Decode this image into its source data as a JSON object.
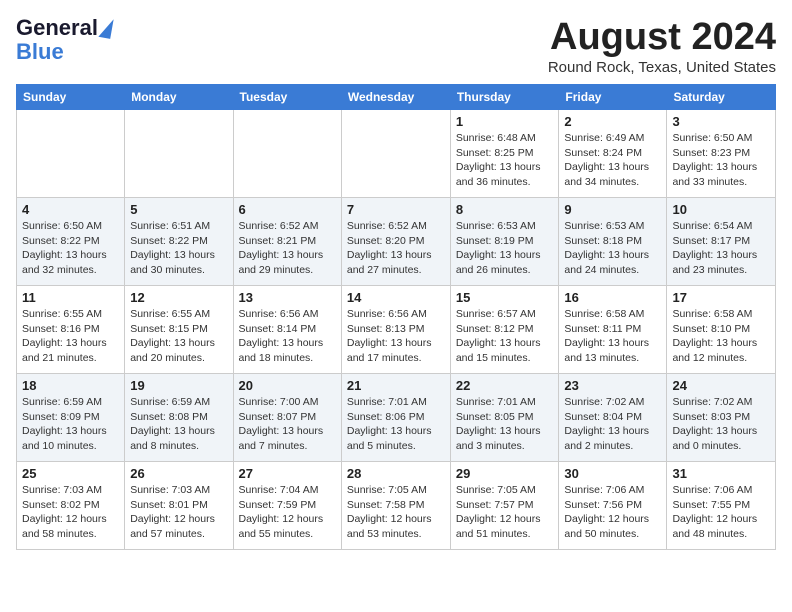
{
  "header": {
    "logo_line1": "General",
    "logo_line2": "Blue",
    "month_title": "August 2024",
    "location": "Round Rock, Texas, United States"
  },
  "days_of_week": [
    "Sunday",
    "Monday",
    "Tuesday",
    "Wednesday",
    "Thursday",
    "Friday",
    "Saturday"
  ],
  "weeks": [
    [
      {
        "day": "",
        "detail": ""
      },
      {
        "day": "",
        "detail": ""
      },
      {
        "day": "",
        "detail": ""
      },
      {
        "day": "",
        "detail": ""
      },
      {
        "day": "1",
        "detail": "Sunrise: 6:48 AM\nSunset: 8:25 PM\nDaylight: 13 hours\nand 36 minutes."
      },
      {
        "day": "2",
        "detail": "Sunrise: 6:49 AM\nSunset: 8:24 PM\nDaylight: 13 hours\nand 34 minutes."
      },
      {
        "day": "3",
        "detail": "Sunrise: 6:50 AM\nSunset: 8:23 PM\nDaylight: 13 hours\nand 33 minutes."
      }
    ],
    [
      {
        "day": "4",
        "detail": "Sunrise: 6:50 AM\nSunset: 8:22 PM\nDaylight: 13 hours\nand 32 minutes."
      },
      {
        "day": "5",
        "detail": "Sunrise: 6:51 AM\nSunset: 8:22 PM\nDaylight: 13 hours\nand 30 minutes."
      },
      {
        "day": "6",
        "detail": "Sunrise: 6:52 AM\nSunset: 8:21 PM\nDaylight: 13 hours\nand 29 minutes."
      },
      {
        "day": "7",
        "detail": "Sunrise: 6:52 AM\nSunset: 8:20 PM\nDaylight: 13 hours\nand 27 minutes."
      },
      {
        "day": "8",
        "detail": "Sunrise: 6:53 AM\nSunset: 8:19 PM\nDaylight: 13 hours\nand 26 minutes."
      },
      {
        "day": "9",
        "detail": "Sunrise: 6:53 AM\nSunset: 8:18 PM\nDaylight: 13 hours\nand 24 minutes."
      },
      {
        "day": "10",
        "detail": "Sunrise: 6:54 AM\nSunset: 8:17 PM\nDaylight: 13 hours\nand 23 minutes."
      }
    ],
    [
      {
        "day": "11",
        "detail": "Sunrise: 6:55 AM\nSunset: 8:16 PM\nDaylight: 13 hours\nand 21 minutes."
      },
      {
        "day": "12",
        "detail": "Sunrise: 6:55 AM\nSunset: 8:15 PM\nDaylight: 13 hours\nand 20 minutes."
      },
      {
        "day": "13",
        "detail": "Sunrise: 6:56 AM\nSunset: 8:14 PM\nDaylight: 13 hours\nand 18 minutes."
      },
      {
        "day": "14",
        "detail": "Sunrise: 6:56 AM\nSunset: 8:13 PM\nDaylight: 13 hours\nand 17 minutes."
      },
      {
        "day": "15",
        "detail": "Sunrise: 6:57 AM\nSunset: 8:12 PM\nDaylight: 13 hours\nand 15 minutes."
      },
      {
        "day": "16",
        "detail": "Sunrise: 6:58 AM\nSunset: 8:11 PM\nDaylight: 13 hours\nand 13 minutes."
      },
      {
        "day": "17",
        "detail": "Sunrise: 6:58 AM\nSunset: 8:10 PM\nDaylight: 13 hours\nand 12 minutes."
      }
    ],
    [
      {
        "day": "18",
        "detail": "Sunrise: 6:59 AM\nSunset: 8:09 PM\nDaylight: 13 hours\nand 10 minutes."
      },
      {
        "day": "19",
        "detail": "Sunrise: 6:59 AM\nSunset: 8:08 PM\nDaylight: 13 hours\nand 8 minutes."
      },
      {
        "day": "20",
        "detail": "Sunrise: 7:00 AM\nSunset: 8:07 PM\nDaylight: 13 hours\nand 7 minutes."
      },
      {
        "day": "21",
        "detail": "Sunrise: 7:01 AM\nSunset: 8:06 PM\nDaylight: 13 hours\nand 5 minutes."
      },
      {
        "day": "22",
        "detail": "Sunrise: 7:01 AM\nSunset: 8:05 PM\nDaylight: 13 hours\nand 3 minutes."
      },
      {
        "day": "23",
        "detail": "Sunrise: 7:02 AM\nSunset: 8:04 PM\nDaylight: 13 hours\nand 2 minutes."
      },
      {
        "day": "24",
        "detail": "Sunrise: 7:02 AM\nSunset: 8:03 PM\nDaylight: 13 hours\nand 0 minutes."
      }
    ],
    [
      {
        "day": "25",
        "detail": "Sunrise: 7:03 AM\nSunset: 8:02 PM\nDaylight: 12 hours\nand 58 minutes."
      },
      {
        "day": "26",
        "detail": "Sunrise: 7:03 AM\nSunset: 8:01 PM\nDaylight: 12 hours\nand 57 minutes."
      },
      {
        "day": "27",
        "detail": "Sunrise: 7:04 AM\nSunset: 7:59 PM\nDaylight: 12 hours\nand 55 minutes."
      },
      {
        "day": "28",
        "detail": "Sunrise: 7:05 AM\nSunset: 7:58 PM\nDaylight: 12 hours\nand 53 minutes."
      },
      {
        "day": "29",
        "detail": "Sunrise: 7:05 AM\nSunset: 7:57 PM\nDaylight: 12 hours\nand 51 minutes."
      },
      {
        "day": "30",
        "detail": "Sunrise: 7:06 AM\nSunset: 7:56 PM\nDaylight: 12 hours\nand 50 minutes."
      },
      {
        "day": "31",
        "detail": "Sunrise: 7:06 AM\nSunset: 7:55 PM\nDaylight: 12 hours\nand 48 minutes."
      }
    ]
  ]
}
